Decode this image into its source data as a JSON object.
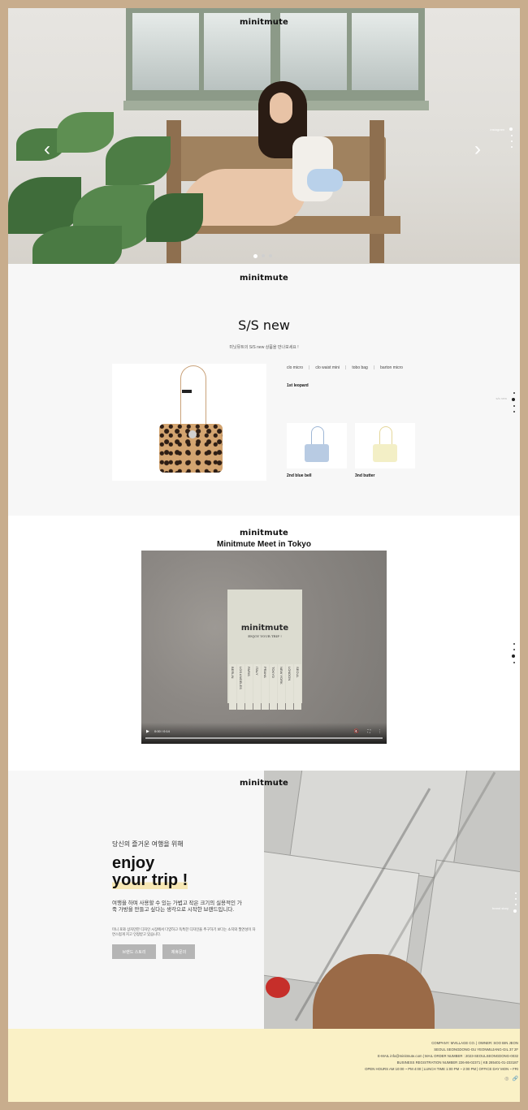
{
  "brand": "minitmute",
  "hero": {
    "prev_arrow": "‹",
    "next_arrow": "›",
    "slide_count": 3,
    "active_slide": 1,
    "side_label": "instagram"
  },
  "ssnew": {
    "title": "S/S new",
    "subtitle": "미닛뮤트의 S/S new 상품을 만나보세요 !",
    "tabs": [
      "clo micro",
      "clo waist mini",
      "tobo bag",
      "barton micro"
    ],
    "tab_separator": "|",
    "main_product_name": "1st leopard",
    "thumbs": [
      {
        "name": "2nd blue bell",
        "color": "#b8cbe3",
        "strap": "#9fb7d6"
      },
      {
        "name": "3nd butter",
        "color": "#f3efc6",
        "strap": "#e4d79a"
      }
    ],
    "side_label": "s/s new"
  },
  "video": {
    "title": "Minitmute Meet in Tokyo",
    "poster_brand": "minitmute",
    "poster_sub": "ENJOY YOUR TRIP !",
    "cities": [
      "BERLIN",
      "LOS ANGELES",
      "PARIS",
      "ITALY",
      "PRAHA",
      "TOKYO",
      "NEW YORK",
      "LONDON",
      "SEOUL"
    ],
    "play_icon": "▶",
    "time": "0:00 / 0:14",
    "mute_icon": "🔇",
    "fullscreen_icon": "⛶",
    "more_icon": "⋮"
  },
  "enjoy": {
    "korean_heading": "당신의 즐거운 여행을 위해",
    "line1": "enjoy",
    "line2": "your trip !",
    "para1": "여행을 하며 사용할 수 있는 가볍고 작은 크기의 실용적인 가죽 가방을 만들고 싶다는 생각으로 시작한 브랜드입니다.",
    "para2": "미니 포와 상자만한 디자인 시장에서 다양하고 독특한 디자인을 추구하기 보다는 소지와 필연성이 자연스럽게 지고 인정받고 있습니다.",
    "button1": "브랜드 스토리",
    "button2": "제휴문의",
    "side_label": "brand story"
  },
  "footer": {
    "lines": [
      "COMPANY: MVILLAGE CO. | OWNER: SOO BIN JEON",
      "SEOUL SEONGDONG-GU YEONMUJANG-GIL 37 2F",
      "E-MAIL info@minitmute.com  |  MAIL ORDER NUMBER : 2023-SEOULSEONGDONG-0032",
      "BUSINESS REGISTRATION NUMBER 226-86-02371 | KB 285401-01-233187",
      "OPEN HOURS AM 10:00 ~ PM 4:00 | LUNCH TIME 1:00 PM ~ 2:00 PM | OFFICE DAY MON ~ FRI"
    ],
    "icons": [
      "instagram-icon",
      "link-icon"
    ]
  }
}
